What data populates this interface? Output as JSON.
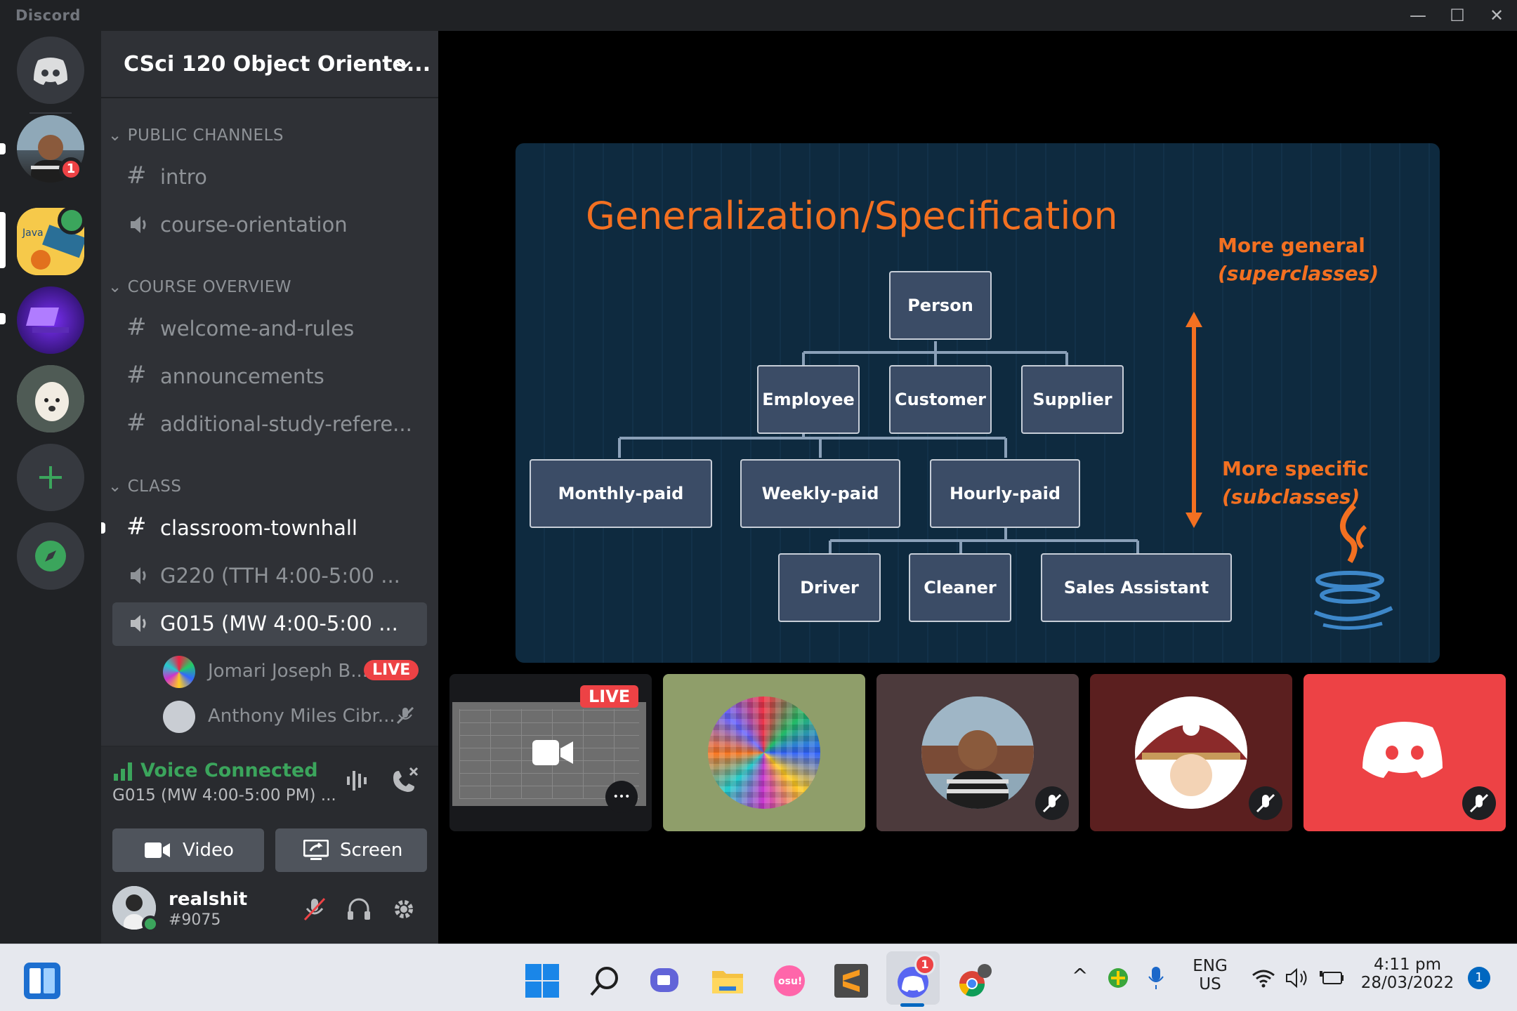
{
  "app": {
    "title": "Discord"
  },
  "window": {
    "minimize": "—",
    "maximize": "☐",
    "close": "✕"
  },
  "server_rail": {
    "mention_count": "1"
  },
  "guild": {
    "name": "CSci 120 Object Oriente...",
    "chevron": "chevron-down-icon"
  },
  "categories": {
    "public": "PUBLIC CHANNELS",
    "overview": "COURSE OVERVIEW",
    "class": "CLASS"
  },
  "channels": {
    "intro": "intro",
    "course_orientation": "course-orientation",
    "welcome": "welcome-and-rules",
    "announcements": "announcements",
    "additional": "additional-study-refere...",
    "townhall": "classroom-townhall",
    "g220": "G220 (TTH 4:00-5:00 ...",
    "g015": "G015 (MW 4:00-5:00 ..."
  },
  "voice_users": [
    {
      "name": "Jomari Joseph B...",
      "badge": "LIVE"
    },
    {
      "name": "Anthony Miles Cibr..."
    }
  ],
  "voice_panel": {
    "status": "Voice Connected",
    "channel": "G015 (MW 4:00-5:00 PM) ...",
    "video_label": "Video",
    "screen_label": "Screen"
  },
  "user": {
    "name": "realshit",
    "tag": "#9075"
  },
  "slide": {
    "title": "Generalization/Specification",
    "nodes": {
      "person": "Person",
      "employee": "Employee",
      "customer": "Customer",
      "supplier": "Supplier",
      "monthly": "Monthly-paid",
      "weekly": "Weekly-paid",
      "hourly": "Hourly-paid",
      "driver": "Driver",
      "cleaner": "Cleaner",
      "sales": "Sales Assistant"
    },
    "general_1": "More general",
    "general_2": "(superclasses)",
    "specific_1": "More specific",
    "specific_2": "(subclasses)",
    "accent": "#f37021"
  },
  "tiles": {
    "live_label": "LIVE",
    "more": "•••"
  },
  "taskbar": {
    "lang_1": "ENG",
    "lang_2": "US",
    "time": "4:11 pm",
    "date": "28/03/2022",
    "notif": "1",
    "discord_badge": "1"
  }
}
